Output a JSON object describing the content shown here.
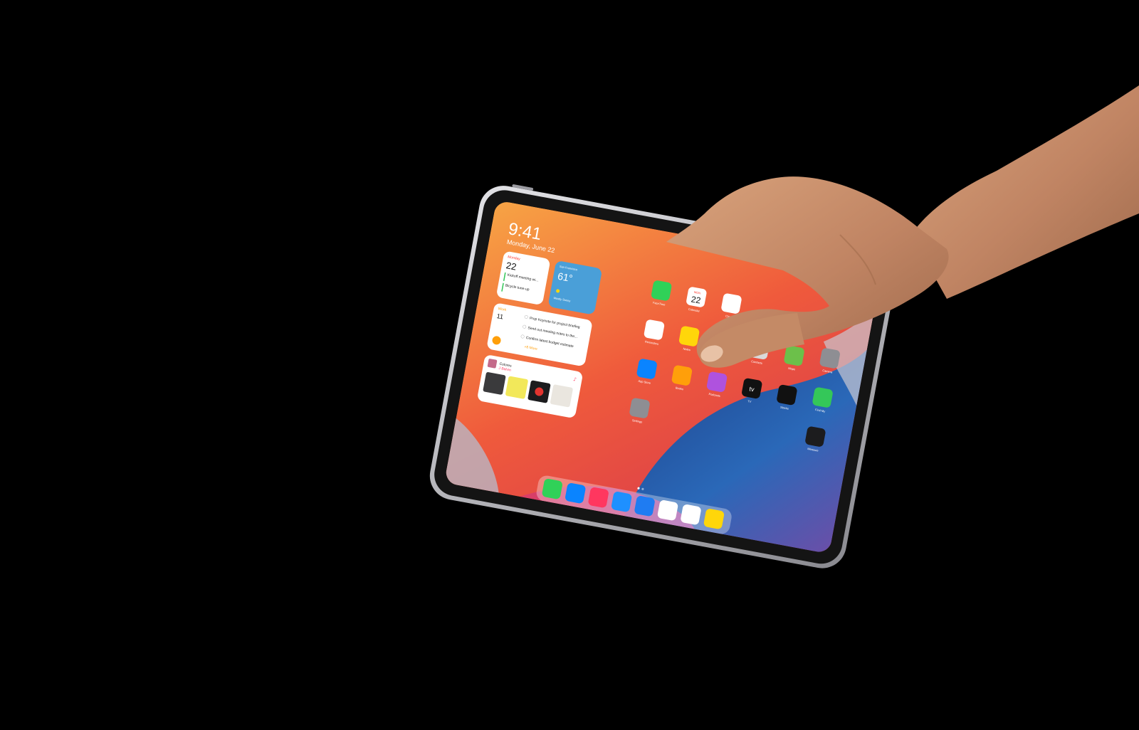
{
  "status": {
    "time": "9:41",
    "date": "Monday, June 22"
  },
  "widgets": {
    "calendar": {
      "day_name": "Monday",
      "day_number": "22",
      "events": [
        "Kickoff meeting wi...",
        "Bicycle tune-up"
      ]
    },
    "weather": {
      "city": "San Francisco",
      "temperature": "61°",
      "condition": "Mostly Sunny"
    },
    "reminders": {
      "list_name": "Work",
      "count": "11",
      "items": [
        "Prep Keynote for project briefing",
        "Send out meeting notes to the...",
        "Confirm latest budget estimate"
      ],
      "more": "+8 More"
    },
    "music": {
      "title": "Colores",
      "artist": "J Balvin"
    }
  },
  "apps": [
    {
      "name": "FaceTime",
      "icon": "facetime-icon",
      "color": "#30d158"
    },
    {
      "name": "Calendar",
      "icon": "calendar-icon",
      "color": "#ffffff",
      "badge_day": "MON",
      "badge_num": "22"
    },
    {
      "name": "Clock",
      "icon": "clock-icon",
      "color": "#ffffff"
    },
    {
      "name": "Reminders",
      "icon": "reminders-icon",
      "color": "#ffffff"
    },
    {
      "name": "Notes",
      "icon": "notes-icon",
      "color": "#ffd60a"
    },
    {
      "name": "Contacts",
      "icon": "contacts-icon",
      "color": "#d9d9d9"
    },
    {
      "name": "Maps",
      "icon": "maps-icon",
      "color": "#6cc04a"
    },
    {
      "name": "Find My",
      "icon": "find-my-icon",
      "color": "#34c759"
    },
    {
      "name": "Camera",
      "icon": "camera-icon",
      "color": "#8e8e93"
    },
    {
      "name": "App Store",
      "icon": "app-store-icon",
      "color": "#0a84ff"
    },
    {
      "name": "Books",
      "icon": "books-icon",
      "color": "#ff9f0a"
    },
    {
      "name": "Podcasts",
      "icon": "podcasts-icon",
      "color": "#af52de"
    },
    {
      "name": "TV",
      "icon": "tv-icon",
      "color": "#111111"
    },
    {
      "name": "Stocks",
      "icon": "stocks-icon",
      "color": "#111111"
    },
    {
      "name": "Measure",
      "icon": "measure-icon",
      "color": "#1c1c1e"
    },
    {
      "name": "Settings",
      "icon": "settings-icon",
      "color": "#8e8e93"
    }
  ],
  "dock": [
    {
      "icon": "messages-icon",
      "color": "#30d158"
    },
    {
      "icon": "safari-icon",
      "color": "#0a84ff"
    },
    {
      "icon": "music-icon",
      "color": "#ff375f"
    },
    {
      "icon": "mail-icon",
      "color": "#1e90ff"
    },
    {
      "icon": "files-icon",
      "color": "#1f7cf2"
    },
    {
      "icon": "photos-icon",
      "color": "#ffffff"
    },
    {
      "icon": "reminders-icon",
      "color": "#ffffff"
    },
    {
      "icon": "notes-icon",
      "color": "#ffd60a"
    }
  ],
  "tv_mark": "tv",
  "colors": {
    "background": "#000000",
    "bezel": "#151515",
    "frame": "#c8c8cc",
    "wallpaper_orange": "#f6983a",
    "wallpaper_red": "#e83a45",
    "wallpaper_blue": "#1f5aa8",
    "skin": "#c9906a"
  }
}
